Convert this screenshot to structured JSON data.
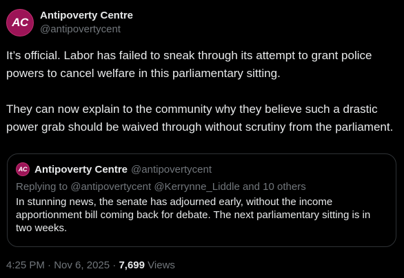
{
  "author": {
    "avatar_initials": "AC",
    "display_name": "Antipoverty Centre",
    "handle": "@antipovertycent"
  },
  "post": {
    "paragraph_1": "It’s official. Labor has failed to sneak through its attempt to grant police powers to cancel welfare in this parliamentary sitting.",
    "paragraph_2": "They can now explain to the community why they believe such a drastic power grab should be waived through without scrutiny from the parliament."
  },
  "quote": {
    "avatar_initials": "AC",
    "display_name": "Antipoverty Centre",
    "handle": "@antipovertycent",
    "reply_line": "Replying to @antipovertycent @Kerrynne_Liddle and 10 others",
    "text": "In stunning news, the senate has adjourned early, without the income apportionment bill coming back for debate. The next parliamentary sitting is in two weeks."
  },
  "meta": {
    "time": "4:25 PM",
    "separator": " · ",
    "date": "Nov 6, 2025",
    "views_count": "7,699",
    "views_label": " Views"
  },
  "colors": {
    "background": "#000000",
    "text_primary": "#e7e9ea",
    "text_secondary": "#71767b",
    "avatar_bg": "#9c1457",
    "border": "#2f3336"
  }
}
